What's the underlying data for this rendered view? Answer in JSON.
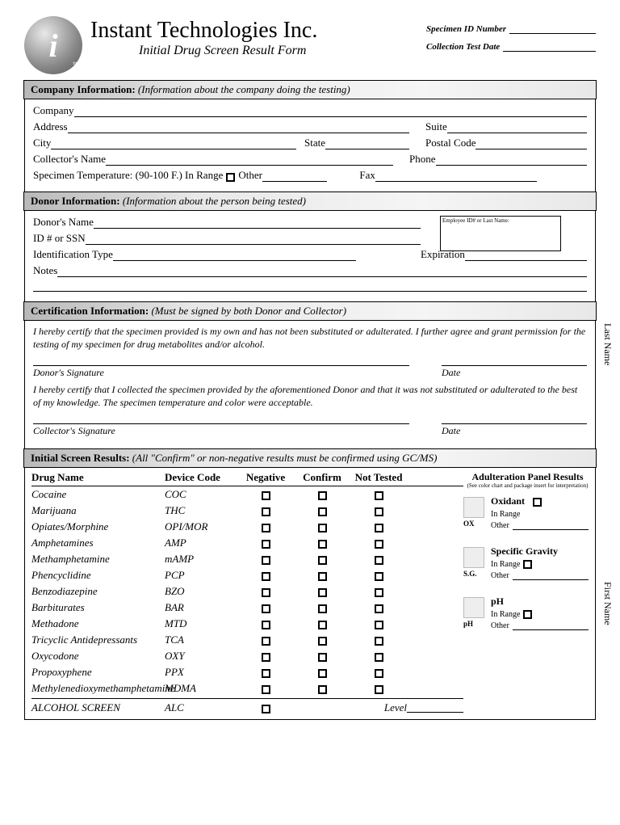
{
  "header": {
    "company": "Instant Technologies Inc.",
    "subtitle": "Initial Drug Screen Result Form",
    "specimen_id_label": "Specimen ID Number",
    "collection_date_label": "Collection Test Date"
  },
  "sections": {
    "company": {
      "title": "Company Information:",
      "subtitle": "(Information about the company doing the testing)",
      "fields": {
        "company": "Company",
        "address": "Address",
        "suite": "Suite",
        "city": "City",
        "state": "State",
        "postal": "Postal Code",
        "collector": "Collector's Name",
        "phone": "Phone",
        "temp": "Specimen Temperature: (90-100 F.) In Range",
        "other": "Other",
        "fax": "Fax"
      }
    },
    "donor": {
      "title": "Donor Information:",
      "subtitle": "(Information about the person being tested)",
      "fields": {
        "name": "Donor's Name",
        "id": "ID # or SSN",
        "idtype": "Identification Type",
        "expiration": "Expiration",
        "notes": "Notes",
        "empbox": "Employee ID# or Last Name:"
      }
    },
    "cert": {
      "title": "Certification Information:",
      "subtitle": "(Must be signed by both Donor and Collector)",
      "donor_text": "I hereby certify that the specimen provided is my own and has not been substituted or adulterated. I further agree and grant permission for the testing of my specimen for drug metabolites and/or alcohol.",
      "donor_sig": "Donor's Signature",
      "date": "Date",
      "collector_text": "I hereby certify that I collected the specimen provided by the aforementioned Donor and that it was not substituted or adulterated to the best of my knowledge. The specimen temperature and color were acceptable.",
      "collector_sig": "Collector's Signature"
    },
    "results": {
      "title": "Initial Screen Results:",
      "subtitle": "(All \"Confirm\" or non-negative results must be confirmed using GC/MS)",
      "cols": {
        "drug": "Drug Name",
        "code": "Device Code",
        "neg": "Negative",
        "conf": "Confirm",
        "nt": "Not Tested"
      },
      "drugs": [
        {
          "name": "Cocaine",
          "code": "COC"
        },
        {
          "name": "Marijuana",
          "code": "THC"
        },
        {
          "name": "Opiates/Morphine",
          "code": "OPI/MOR"
        },
        {
          "name": "Amphetamines",
          "code": "AMP"
        },
        {
          "name": "Methamphetamine",
          "code": "mAMP"
        },
        {
          "name": "Phencyclidine",
          "code": "PCP"
        },
        {
          "name": "Benzodiazepine",
          "code": "BZO"
        },
        {
          "name": "Barbiturates",
          "code": "BAR"
        },
        {
          "name": "Methadone",
          "code": "MTD"
        },
        {
          "name": "Tricyclic Antidepressants",
          "code": "TCA"
        },
        {
          "name": "Oxycodone",
          "code": "OXY"
        },
        {
          "name": "Propoxyphene",
          "code": "PPX"
        },
        {
          "name": "Methylenedioxymethamphetamine",
          "code": "MDMA"
        }
      ],
      "alcohol": {
        "name": "ALCOHOL SCREEN",
        "code": "ALC",
        "level": "Level"
      }
    },
    "panel": {
      "title": "Adulteration Panel Results",
      "note": "(See color chart and package insert for interpretation)",
      "items": [
        {
          "name": "Oxidant",
          "abbr": "OX",
          "in_range": "In Range",
          "other": "Other"
        },
        {
          "name": "Specific Gravity",
          "abbr": "S.G.",
          "in_range": "In Range",
          "other": "Other"
        },
        {
          "name": "pH",
          "abbr": "pH",
          "in_range": "In Range",
          "other": "Other"
        }
      ]
    }
  },
  "side_labels": {
    "last": "Last Name",
    "first": "First Name"
  }
}
